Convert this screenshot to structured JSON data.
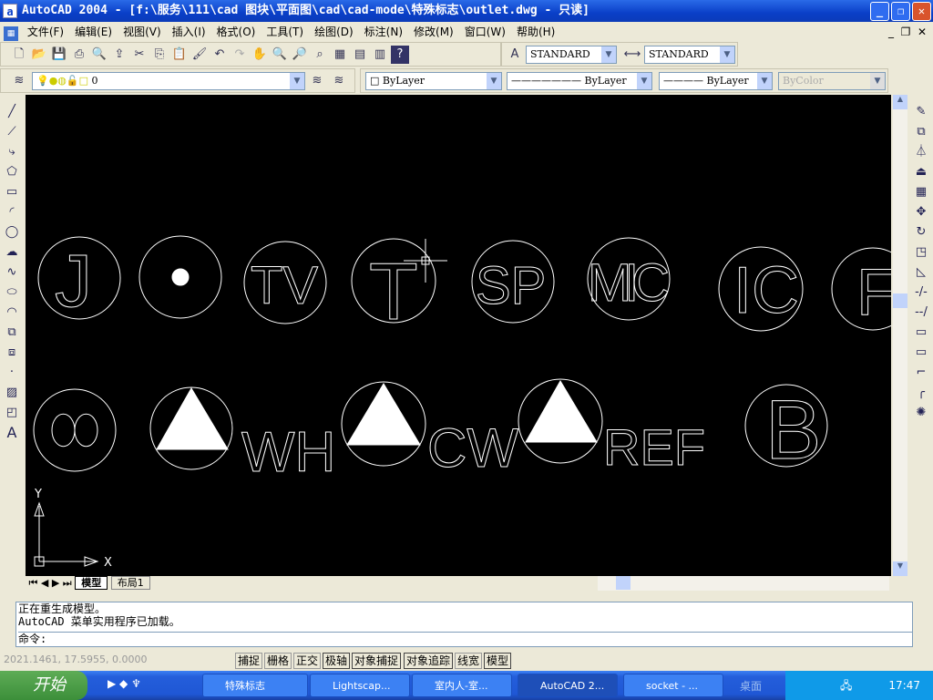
{
  "title": "AutoCAD 2004 - [f:\\服务\\111\\cad 图块\\平面图\\cad\\cad-mode\\特殊标志\\outlet.dwg - 只读]",
  "menu": [
    "文件(F)",
    "编辑(E)",
    "视图(V)",
    "插入(I)",
    "格式(O)",
    "工具(T)",
    "绘图(D)",
    "标注(N)",
    "修改(M)",
    "窗口(W)",
    "帮助(H)"
  ],
  "toolbar": {
    "text_style": "STANDARD",
    "dim_style": "STANDARD",
    "layer": "0",
    "color": "ByLayer",
    "linetype": "ByLayer",
    "lineweight": "ByLayer",
    "plot_style": "ByColor"
  },
  "drawing": {
    "symbols_row1": [
      "J",
      "TV",
      "T",
      "SP",
      "MIC",
      "IC",
      "F"
    ],
    "symbols_row2": [
      "WH",
      "CW",
      "REF",
      "B"
    ],
    "ucs_x": "X",
    "ucs_y": "Y"
  },
  "tabs": {
    "model": "模型",
    "layout1": "布局1"
  },
  "command": {
    "line1": "正在重生成模型。",
    "line2": "AutoCAD 菜单实用程序已加载。",
    "prompt": "命令:"
  },
  "status": {
    "coords": "2021.1461, 17.5955, 0.0000",
    "buttons": [
      "捕捉",
      "栅格",
      "正交",
      "极轴",
      "对象捕捉",
      "对象追踪",
      "线宽",
      "模型"
    ]
  },
  "taskbar": {
    "start": "开始",
    "tasks": [
      "特殊标志",
      "Lightscap...",
      "室内人-室...",
      "AutoCAD 2...",
      "socket - ..."
    ],
    "desktop": "桌面",
    "clock": "17:47"
  }
}
